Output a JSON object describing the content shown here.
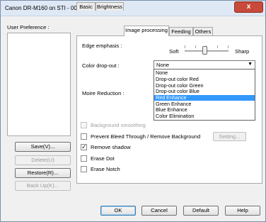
{
  "window": {
    "title": "Canon DR-M160 on STI - 0002",
    "close_glyph": "x"
  },
  "user_preference": {
    "label": "User Preference :",
    "items": [],
    "buttons": {
      "save": "Save(V)...",
      "delete": "Delete(U)",
      "restore": "Restore(R)...",
      "backup": "Back Up(K)..."
    }
  },
  "tabs": [
    {
      "label": "Basic",
      "active": false
    },
    {
      "label": "Brightness",
      "active": false
    },
    {
      "label": "Image processing",
      "active": true
    },
    {
      "label": "Feeding",
      "active": false
    },
    {
      "label": "Others",
      "active": false
    }
  ],
  "image_processing": {
    "edge_emphasis": {
      "label": "Edge emphasis :",
      "min_label": "Soft",
      "max_label": "Sharp",
      "level": 0.45
    },
    "color_dropout": {
      "label": "Color drop-out :",
      "value": "None",
      "options": [
        "None",
        "Drop-out color Red",
        "Drop-out color Green",
        "Drop-out color Blue",
        "Red Enhance",
        "Green Enhance",
        "Blue Enhance",
        "Color Elimination"
      ],
      "highlighted_index": 4
    },
    "moire_reduction": {
      "label": "Moire Reduction :"
    },
    "checkboxes": {
      "background_smoothing": {
        "label": "Background smoothing",
        "checked": false,
        "enabled": false
      },
      "prevent_bleed": {
        "label": "Prevent Bleed Through / Remove Background",
        "checked": false,
        "enabled": true
      },
      "remove_shadow": {
        "label": "Remove shadow",
        "checked": true,
        "enabled": true
      },
      "erase_dot": {
        "label": "Erase Dot",
        "checked": false,
        "enabled": true
      },
      "erase_notch": {
        "label": "Erase Notch",
        "checked": false,
        "enabled": true
      }
    },
    "setting_button": "Setting..."
  },
  "footer": {
    "ok": "OK",
    "cancel": "Cancel",
    "default": "Default",
    "help": "Help"
  }
}
